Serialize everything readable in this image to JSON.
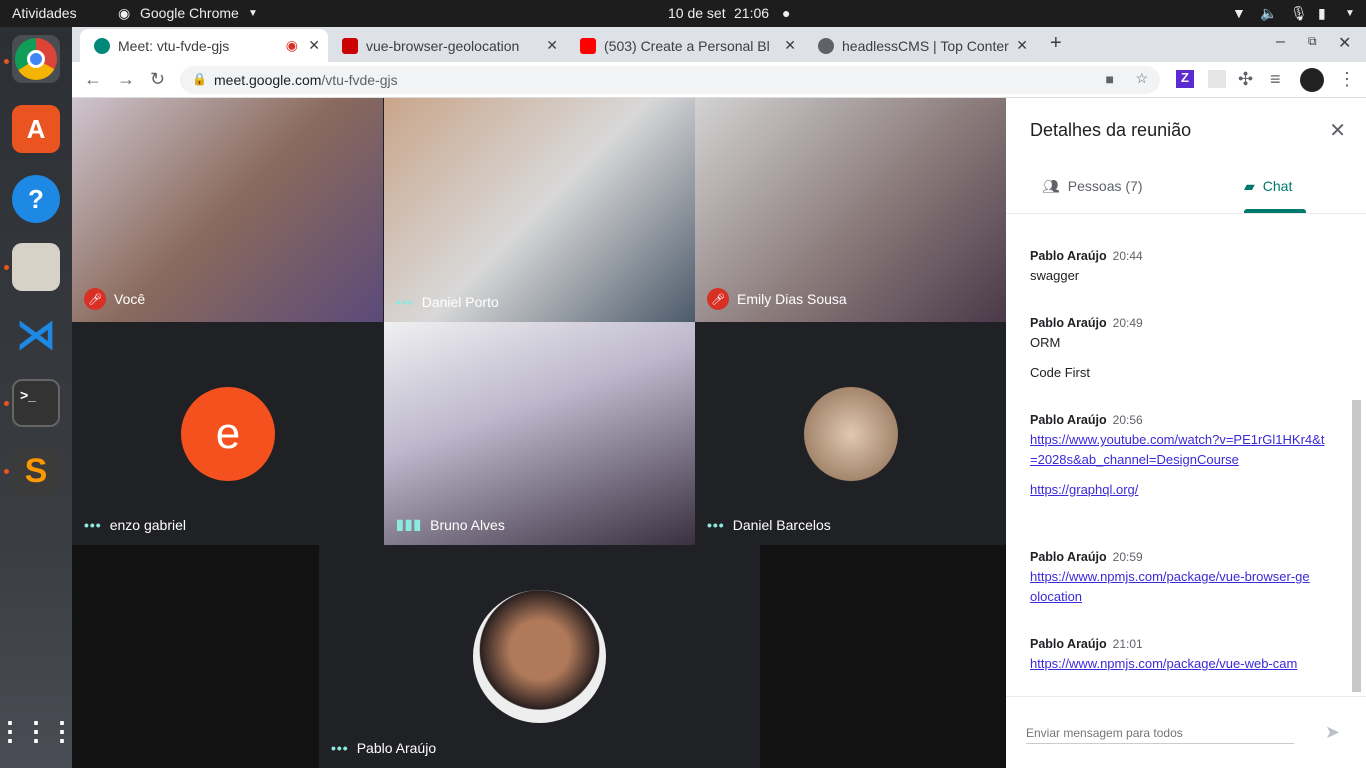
{
  "system": {
    "activities": "Atividades",
    "app": "Google Chrome",
    "date": "10 de set",
    "time": "21:06"
  },
  "tabs": [
    {
      "title": "Meet: vtu-fvde-gjs",
      "color": "#00897b"
    },
    {
      "title": "vue-browser-geolocation",
      "color": "#cb0000"
    },
    {
      "title": "(503) Create a Personal Bl",
      "color": "#ff0000"
    },
    {
      "title": "headlessCMS | Top Conter",
      "color": "#5f6368"
    }
  ],
  "url": {
    "host": "meet.google.com",
    "path": "/vtu-fvde-gjs"
  },
  "participants": [
    {
      "name": "Você",
      "status": "muted"
    },
    {
      "name": "Daniel Porto",
      "status": "dots"
    },
    {
      "name": "Emily Dias Sousa",
      "status": "muted"
    },
    {
      "name": "enzo gabriel",
      "status": "dots",
      "initial": "e"
    },
    {
      "name": "Bruno Alves",
      "status": "speaking"
    },
    {
      "name": "Daniel Barcelos",
      "status": "dots"
    },
    {
      "name": "Pablo Araújo",
      "status": "dots"
    }
  ],
  "panel": {
    "title": "Detalhes da reunião",
    "people_tab": "Pessoas (7)",
    "chat_tab": "Chat",
    "input_placeholder": "Enviar mensagem para todos"
  },
  "messages": [
    {
      "sender": "Pablo Araújo",
      "time": "20:44",
      "lines": [
        "swagger"
      ]
    },
    {
      "sender": "Pablo Araújo",
      "time": "20:49",
      "lines": [
        "ORM",
        "Code First"
      ]
    },
    {
      "sender": "Pablo Araújo",
      "time": "20:56",
      "links": [
        "https://www.youtube.com/watch?v=PE1rGl1HKr4&t=2028s&ab_channel=DesignCourse",
        "https://graphql.org/"
      ]
    },
    {
      "sender": "Pablo Araújo",
      "time": "20:59",
      "links": [
        "https://www.npmjs.com/package/vue-browser-geolocation"
      ]
    },
    {
      "sender": "Pablo Araújo",
      "time": "21:01",
      "links": [
        "https://www.npmjs.com/package/vue-web-cam"
      ]
    }
  ]
}
